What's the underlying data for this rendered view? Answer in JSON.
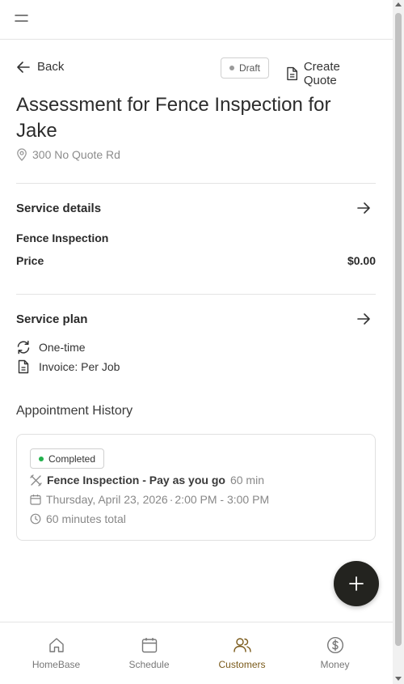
{
  "header": {
    "menu_icon": "hamburger-icon"
  },
  "nav": {
    "back_label": "Back",
    "status_label": "Draft",
    "create_quote_label": "Create Quote"
  },
  "job": {
    "title": "Assessment for Fence Inspection for Jake",
    "address": "300 No Quote Rd"
  },
  "service_details": {
    "heading": "Service details",
    "service_name": "Fence Inspection",
    "price_label": "Price",
    "price_value": "$0.00"
  },
  "service_plan": {
    "heading": "Service plan",
    "frequency": "One-time",
    "invoice": "Invoice: Per Job"
  },
  "appointment_history": {
    "heading": "Appointment History",
    "items": [
      {
        "status": "Completed",
        "service": "Fence Inspection - Pay as you go",
        "duration": "60 min",
        "date": "Thursday, April 23, 2026",
        "separator": "·",
        "time": "2:00 PM - 3:00 PM",
        "total": "60 minutes total"
      }
    ]
  },
  "bottom_nav": {
    "items": [
      {
        "label": "HomeBase",
        "icon": "home-icon"
      },
      {
        "label": "Schedule",
        "icon": "calendar-icon"
      },
      {
        "label": "Customers",
        "icon": "users-icon",
        "active": true
      },
      {
        "label": "Money",
        "icon": "dollar-icon"
      }
    ]
  },
  "colors": {
    "accent": "#7a5a1a",
    "fab": "#23231f",
    "completed_dot": "#22b14c",
    "draft_dot": "#9a9a9a"
  }
}
